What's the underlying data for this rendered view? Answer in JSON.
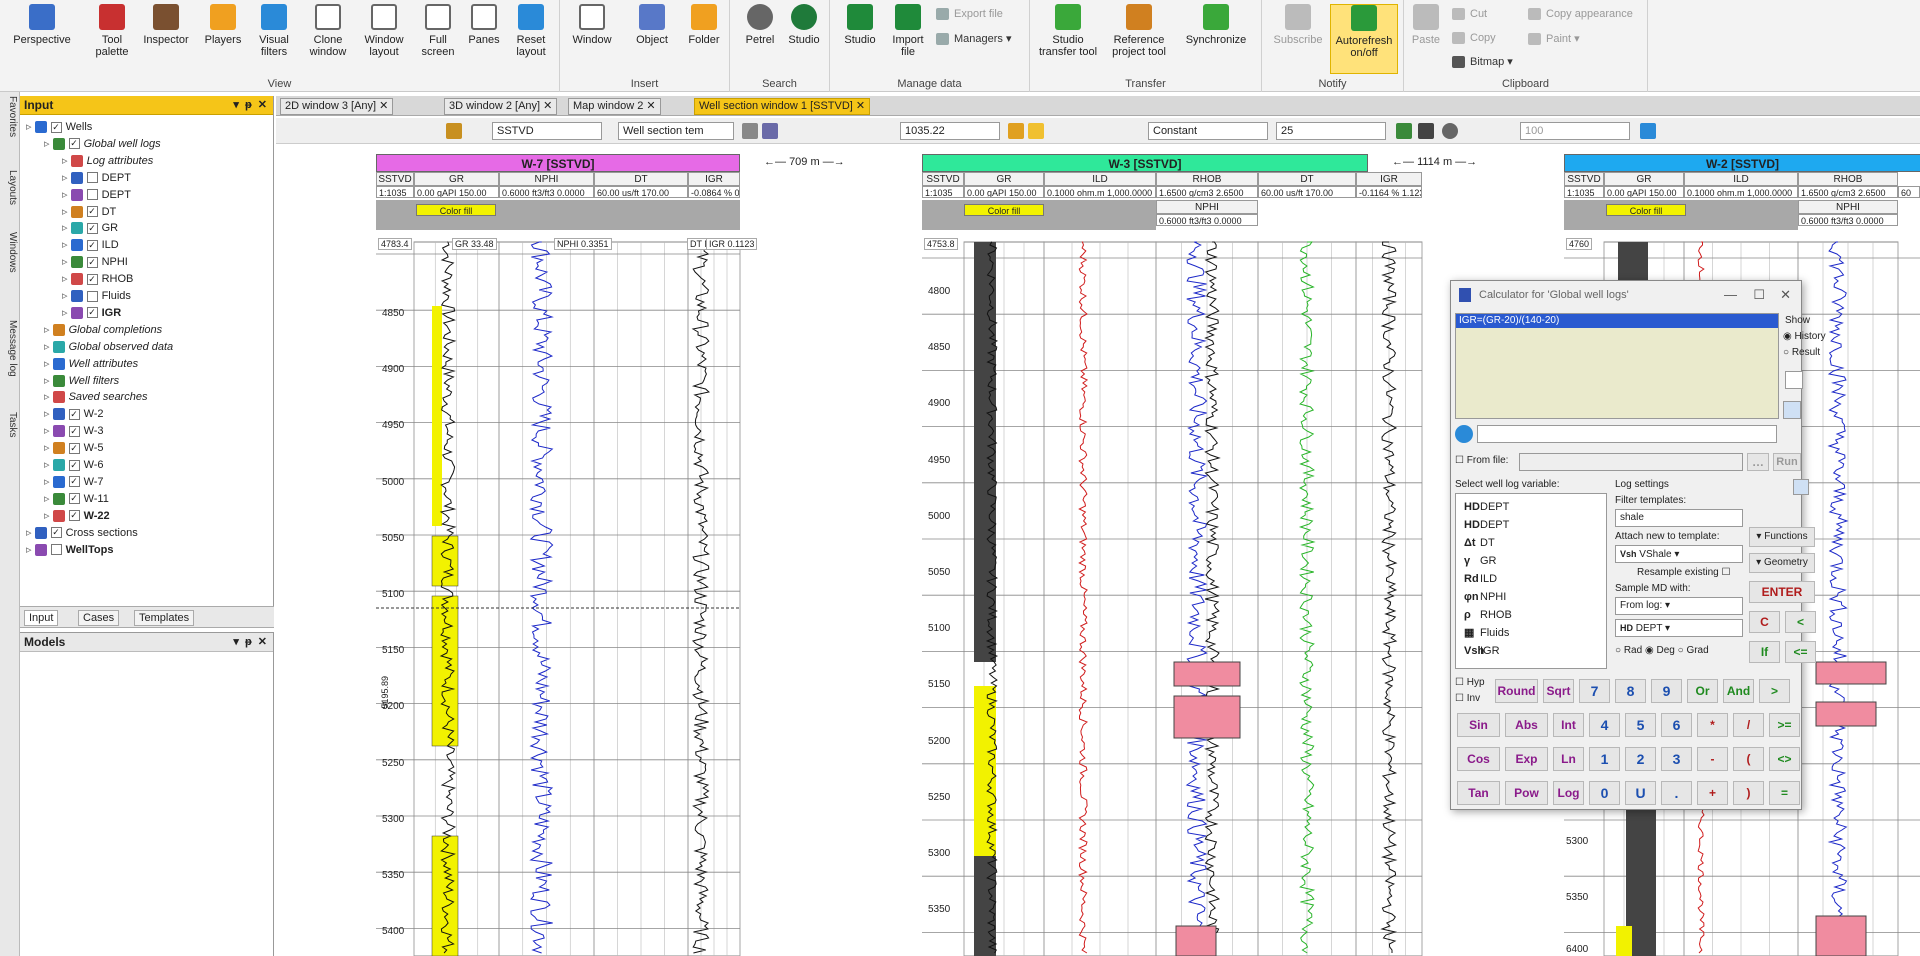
{
  "ribbon": {
    "groups": [
      {
        "label": "View"
      },
      {
        "label": "Insert"
      },
      {
        "label": "Search"
      },
      {
        "label": "Manage data"
      },
      {
        "label": "Transfer"
      },
      {
        "label": "Notify"
      },
      {
        "label": "Clipboard"
      }
    ],
    "perspective": "Perspective",
    "tool_palette_1": "Tool",
    "tool_palette_2": "palette",
    "inspector": "Inspector",
    "players": "Players",
    "visual_filters_1": "Visual",
    "visual_filters_2": "filters",
    "clone_window_1": "Clone",
    "clone_window_2": "window",
    "window_layout_1": "Window",
    "window_layout_2": "layout",
    "full_screen_1": "Full",
    "full_screen_2": "screen",
    "panes": "Panes",
    "reset_layout_1": "Reset",
    "reset_layout_2": "layout",
    "window": "Window",
    "object": "Object",
    "folder": "Folder",
    "petrel": "Petrel",
    "studio_search": "Studio",
    "studio": "Studio",
    "import_file_1": "Import",
    "import_file_2": "file",
    "export_file": "Export file",
    "managers": "Managers",
    "studio_transfer_1": "Studio",
    "studio_transfer_2": "transfer tool",
    "reference_1": "Reference",
    "reference_2": "project tool",
    "synchronize": "Synchronize",
    "subscribe": "Subscribe",
    "autorefresh_1": "Autorefresh",
    "autorefresh_2": "on/off",
    "paste": "Paste",
    "cut": "Cut",
    "copy": "Copy",
    "bitmap": "Bitmap",
    "copy_appearance": "Copy appearance",
    "paint": "Paint"
  },
  "left_tabs": [
    "Favorites",
    "Layouts",
    "Windows",
    "Message log",
    "Tasks"
  ],
  "input_panel": {
    "title": "Input",
    "tree": [
      {
        "label": "Wells",
        "indent": 0,
        "checked": true,
        "bold": false,
        "italic": false
      },
      {
        "label": "Global well logs",
        "indent": 1,
        "checked": true,
        "bold": false,
        "italic": true
      },
      {
        "label": "Log attributes",
        "indent": 2,
        "checked": null,
        "bold": false,
        "italic": true
      },
      {
        "label": "DEPT",
        "indent": 2,
        "checked": false,
        "bold": false,
        "italic": false
      },
      {
        "label": "DEPT",
        "indent": 2,
        "checked": false,
        "bold": false,
        "italic": false
      },
      {
        "label": "DT",
        "indent": 2,
        "checked": true,
        "bold": false,
        "italic": false
      },
      {
        "label": "GR",
        "indent": 2,
        "checked": true,
        "bold": false,
        "italic": false
      },
      {
        "label": "ILD",
        "indent": 2,
        "checked": true,
        "bold": false,
        "italic": false
      },
      {
        "label": "NPHI",
        "indent": 2,
        "checked": true,
        "bold": false,
        "italic": false
      },
      {
        "label": "RHOB",
        "indent": 2,
        "checked": true,
        "bold": false,
        "italic": false
      },
      {
        "label": "Fluids",
        "indent": 2,
        "checked": false,
        "bold": false,
        "italic": false
      },
      {
        "label": "IGR",
        "indent": 2,
        "checked": true,
        "bold": true,
        "italic": false
      },
      {
        "label": "Global completions",
        "indent": 1,
        "checked": null,
        "bold": false,
        "italic": true
      },
      {
        "label": "Global observed data",
        "indent": 1,
        "checked": null,
        "bold": false,
        "italic": true
      },
      {
        "label": "Well attributes",
        "indent": 1,
        "checked": null,
        "bold": false,
        "italic": true
      },
      {
        "label": "Well filters",
        "indent": 1,
        "checked": null,
        "bold": false,
        "italic": true
      },
      {
        "label": "Saved searches",
        "indent": 1,
        "checked": null,
        "bold": false,
        "italic": true
      },
      {
        "label": "W-2",
        "indent": 1,
        "checked": true,
        "bold": false,
        "italic": false
      },
      {
        "label": "W-3",
        "indent": 1,
        "checked": true,
        "bold": false,
        "italic": false
      },
      {
        "label": "W-5",
        "indent": 1,
        "checked": true,
        "bold": false,
        "italic": false
      },
      {
        "label": "W-6",
        "indent": 1,
        "checked": true,
        "bold": false,
        "italic": false
      },
      {
        "label": "W-7",
        "indent": 1,
        "checked": true,
        "bold": false,
        "italic": false
      },
      {
        "label": "W-11",
        "indent": 1,
        "checked": true,
        "bold": false,
        "italic": false
      },
      {
        "label": "W-22",
        "indent": 1,
        "checked": true,
        "bold": true,
        "italic": false
      },
      {
        "label": "Cross sections",
        "indent": 0,
        "checked": true,
        "bold": false,
        "italic": false
      },
      {
        "label": "WellTops",
        "indent": 0,
        "checked": false,
        "bold": true,
        "italic": false
      }
    ],
    "tabs": [
      "Input",
      "Cases",
      "Templates"
    ]
  },
  "models_panel": {
    "title": "Models"
  },
  "doc_tabs": [
    "2D window 3 [Any]",
    "3D window 2 [Any]",
    "Map window 2",
    "Well section window 1 [SSTVD]"
  ],
  "toolbar": {
    "domain": "SSTVD",
    "template": "Well section tem",
    "depth_value": "1035.22",
    "scaling": "Constant",
    "num_value": "25",
    "opacity_value": "100"
  },
  "wells": [
    {
      "name": "W-7 [SSTVD]",
      "color": "#e66ae6"
    },
    {
      "name": "W-3 [SSTVD]",
      "color": "#2fe89a"
    },
    {
      "name": "W-2 [SSTVD]",
      "color": "#1ea9f0"
    }
  ],
  "distances": [
    "709 m",
    "1114 m"
  ],
  "tracks": {
    "w7": [
      "GR",
      "NPHI",
      "DT",
      "IGR"
    ],
    "w3": [
      "GR",
      "ILD",
      "RHOB",
      "DT",
      "IGR"
    ],
    "w2": [
      "GR",
      "ILD",
      "RHOB"
    ]
  },
  "scales": {
    "sstvd": "SSTVD",
    "ratio": "1:1035",
    "gr": "0.00  gAPI  150.00",
    "nphi": "0.6000 ft3/ft3 0.0000",
    "dt": "60.00      us/ft      170.00",
    "igr": "-0.0864  %  0.7180",
    "igr_w3": "-0.1164  %  1.1231",
    "ild": "0.1000 ohm.m 1,000.0000",
    "rhob": "1.6500 g/cm3 2.6500",
    "nphi_w3": "0.6000 ft3/ft3 0.0000",
    "color_fill": "Color fill",
    "nphi_label": "NPHI",
    "trunc": "60"
  },
  "readouts": {
    "w7_top": "4783.4",
    "w7_gr": "GR 33.48",
    "w7_nphi": "NPHI 0.3351",
    "w7_dt": "DT NaN",
    "w7_igr": "IGR 0.1123",
    "w3_top": "4753.8",
    "w2_top": "4760",
    "w7_marker": "5195.89"
  },
  "depths": {
    "w7": [
      "4850",
      "4900",
      "4950",
      "5000",
      "5050",
      "5100",
      "5150",
      "5200",
      "5250",
      "5300",
      "5350",
      "5400"
    ],
    "w3": [
      "4800",
      "4850",
      "4900",
      "4950",
      "5000",
      "5050",
      "5100",
      "5150",
      "5200",
      "5250",
      "5300",
      "5350"
    ],
    "w2": [
      "5300",
      "5350"
    ],
    "w2_edge": "6400"
  },
  "calculator": {
    "title": "Calculator for 'Global well logs'",
    "expression": "IGR=(GR-20)/(140-20)",
    "show_label": "Show",
    "history": "History",
    "result": "Result",
    "from_file": "From file:",
    "run": "Run",
    "select_var": "Select well log variable:",
    "variables": [
      {
        "icon": "HD",
        "label": "DEPT"
      },
      {
        "icon": "HD",
        "label": "DEPT"
      },
      {
        "icon": "Δt",
        "label": "DT"
      },
      {
        "icon": "γ",
        "label": "GR"
      },
      {
        "icon": "Rd",
        "label": "ILD"
      },
      {
        "icon": "φn",
        "label": "NPHI"
      },
      {
        "icon": "ρ",
        "label": "RHOB"
      },
      {
        "icon": "▦",
        "label": "Fluids"
      },
      {
        "icon": "Vsh",
        "label": "IGR"
      }
    ],
    "log_settings": "Log settings",
    "filter_templates": "Filter templates:",
    "filter_value": "shale",
    "attach_template": "Attach new to template:",
    "attach_value": "VShale",
    "resample": "Resample existing",
    "sample_md": "Sample MD with:",
    "sample_value": "From log:",
    "dept_value": "DEPT",
    "functions": "Functions",
    "geometry": "Geometry",
    "enter": "ENTER",
    "rad": "Rad",
    "deg": "Deg",
    "grad": "Grad",
    "hyp": "Hyp",
    "inv": "Inv",
    "keys": [
      [
        "Round",
        "Sqrt",
        "7",
        "8",
        "9",
        "Or",
        "And",
        ">"
      ],
      [
        "Sin",
        "Abs",
        "Int",
        "4",
        "5",
        "6",
        "*",
        "/",
        ">="
      ],
      [
        "Cos",
        "Exp",
        "Ln",
        "1",
        "2",
        "3",
        "-",
        "(",
        "<>"
      ],
      [
        "Tan",
        "Pow",
        "Log",
        "0",
        "U",
        ".",
        "+",
        ")",
        "="
      ]
    ],
    "c_key": "C",
    "lt_key": "<",
    "if_key": "If",
    "le_key": "<="
  },
  "colors": {
    "accent": "#f5c518",
    "gr_fill": "#f2f200",
    "rhob_fill": "#f08ca0",
    "ild": "#d01c1c",
    "dt": "#28b428",
    "nphi": "#1c28c8"
  }
}
